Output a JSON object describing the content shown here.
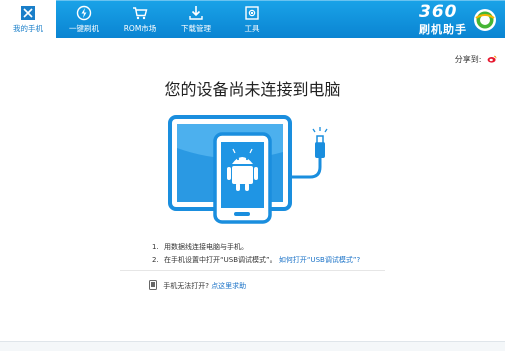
{
  "nav": {
    "tabs": [
      {
        "label": "我的手机",
        "icon": "phone-icon"
      },
      {
        "label": "一键刷机",
        "icon": "flash-icon"
      },
      {
        "label": "ROM市场",
        "icon": "cart-icon"
      },
      {
        "label": "下载管理",
        "icon": "download-icon"
      },
      {
        "label": "工具",
        "icon": "toolbox-icon"
      }
    ],
    "active": "我的手机"
  },
  "brand": {
    "number": "360",
    "name": "刷机助手"
  },
  "share": {
    "label": "分享到:",
    "icon": "weibo-icon"
  },
  "main": {
    "title": "您的设备尚未连接到电脑",
    "steps": [
      {
        "num": "1.",
        "text": "用数据线连接电脑与手机。"
      },
      {
        "num": "2.",
        "text": "在手机设置中打开“USB调试模式”。",
        "link": "如何打开“USB调试模式”?"
      }
    ],
    "help": {
      "text": "手机无法打开?",
      "link": "点这里求助"
    }
  },
  "colors": {
    "topbar": "#0a8fdc",
    "accent": "#1a7fc9",
    "link": "#1a72c7"
  }
}
